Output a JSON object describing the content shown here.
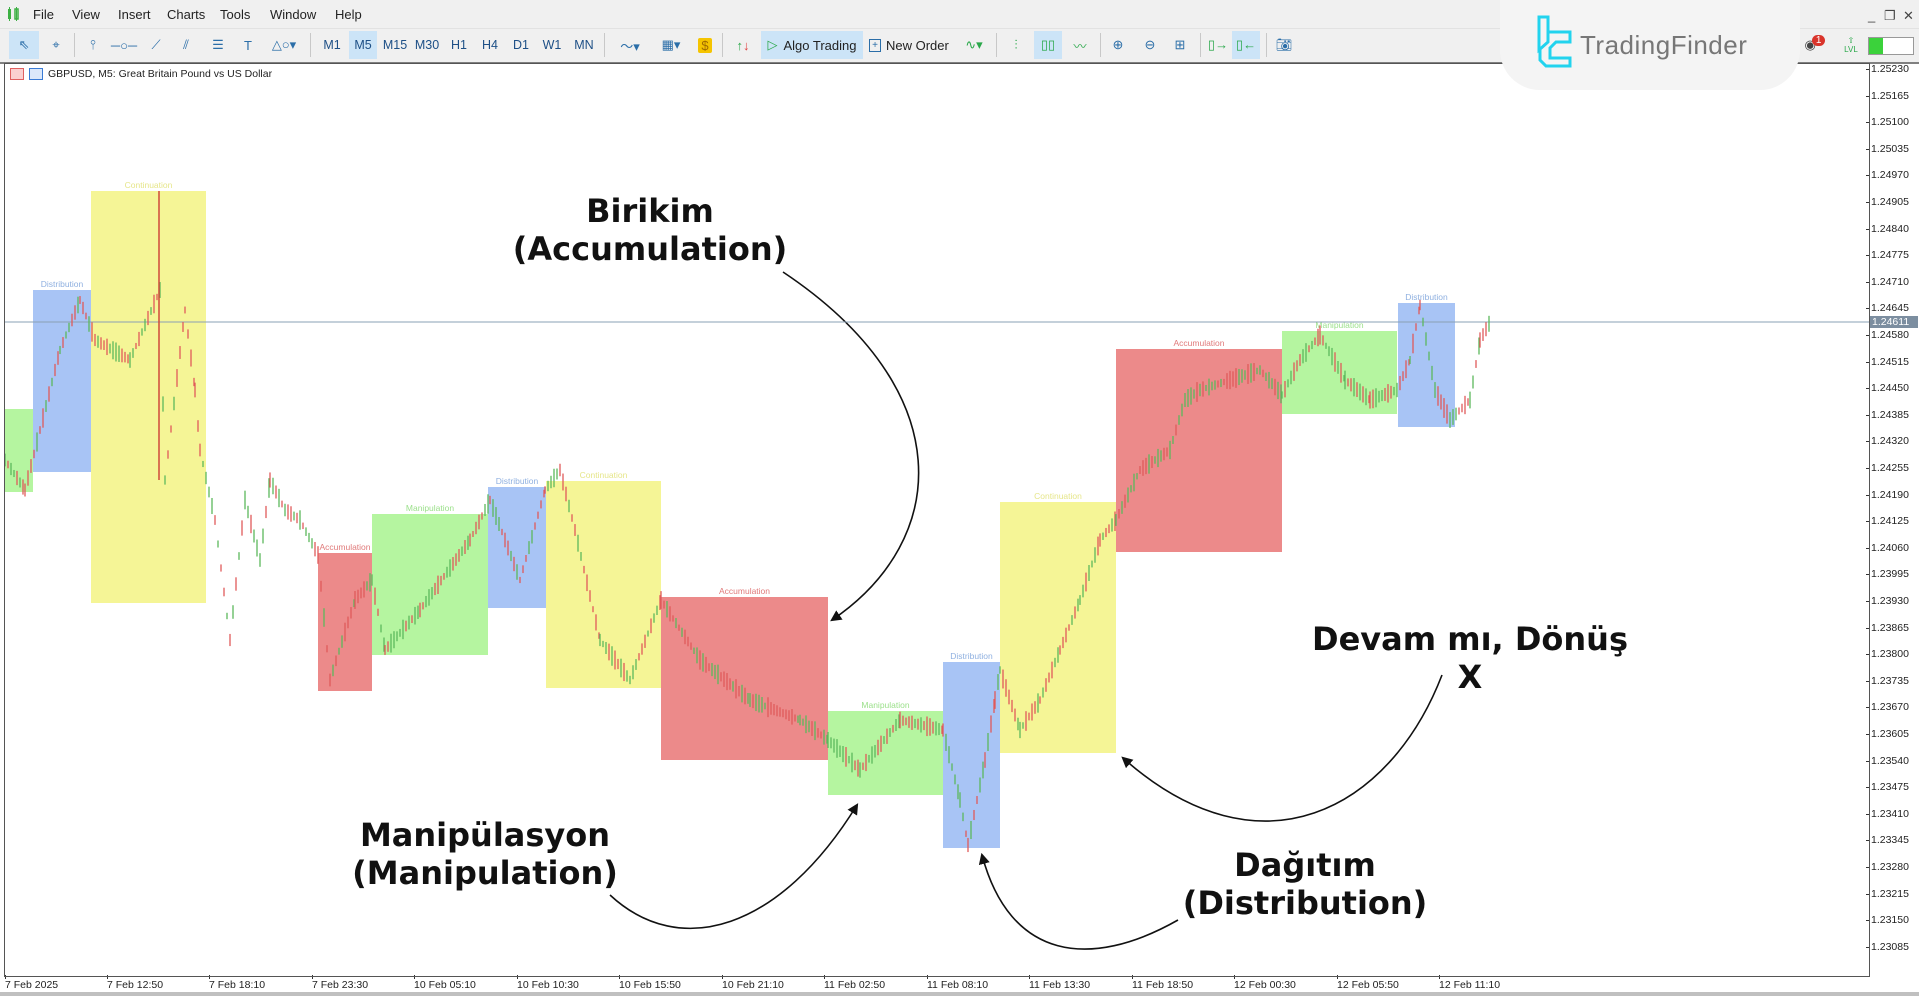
{
  "menu": {
    "items": [
      "File",
      "View",
      "Insert",
      "Charts",
      "Tools",
      "Window",
      "Help"
    ]
  },
  "toolbar": {
    "timeframes": [
      "M1",
      "M5",
      "M15",
      "M30",
      "H1",
      "H4",
      "D1",
      "W1",
      "MN"
    ],
    "active_timeframe": "M5",
    "algo_trading_label": "Algo Trading",
    "new_order_label": "New Order",
    "notification_count": "1",
    "level_label": "LVL"
  },
  "brand": {
    "name": "TradingFinder",
    "accent": "#22d3ee"
  },
  "chart": {
    "title": "GBPUSD, M5:  Great Britain Pound vs US Dollar",
    "current_price": "1.24611",
    "price_labels": [
      "1.25230",
      "1.25165",
      "1.25100",
      "1.25035",
      "1.24970",
      "1.24905",
      "1.24840",
      "1.24775",
      "1.24710",
      "1.24645",
      "1.24580",
      "1.24515",
      "1.24450",
      "1.24385",
      "1.24320",
      "1.24255",
      "1.24190",
      "1.24125",
      "1.24060",
      "1.23995",
      "1.23930",
      "1.23865",
      "1.23800",
      "1.23735",
      "1.23670",
      "1.23605",
      "1.23540",
      "1.23475",
      "1.23410",
      "1.23345",
      "1.23280",
      "1.23215",
      "1.23150",
      "1.23085"
    ],
    "time_labels": [
      "7 Feb 2025",
      "7 Feb 12:50",
      "7 Feb 18:10",
      "7 Feb 23:30",
      "10 Feb 05:10",
      "10 Feb 10:30",
      "10 Feb 15:50",
      "10 Feb 21:10",
      "11 Feb 02:50",
      "11 Feb 08:10",
      "11 Feb 13:30",
      "11 Feb 18:50",
      "12 Feb 00:30",
      "12 Feb 05:50",
      "12 Feb 11:10"
    ],
    "phase_colors": {
      "Accumulation": "#ec8a8a",
      "Manipulation": "#b5f5a0",
      "Distribution": "#a8c4f5",
      "Continuation": "#f5f596"
    },
    "phases": [
      {
        "type": "Manipulation",
        "label": ""
      },
      {
        "type": "Distribution",
        "label": "Distribution"
      },
      {
        "type": "Continuation",
        "label": "Continuation"
      },
      {
        "type": "Accumulation",
        "label": "Accumulation"
      },
      {
        "type": "Manipulation",
        "label": "Manipulation"
      },
      {
        "type": "Distribution",
        "label": "Distribution"
      },
      {
        "type": "Continuation",
        "label": "Continuation"
      },
      {
        "type": "Accumulation",
        "label": "Accumulation"
      },
      {
        "type": "Manipulation",
        "label": "Manipulation"
      },
      {
        "type": "Distribution",
        "label": "Distribution"
      },
      {
        "type": "Continuation",
        "label": "Continuation"
      },
      {
        "type": "Accumulation",
        "label": "Accumulation"
      },
      {
        "type": "Manipulation",
        "label": "Manipulation"
      },
      {
        "type": "Distribution",
        "label": "Distribution"
      }
    ]
  },
  "annotations": {
    "accumulation": {
      "line1": "Birikim",
      "line2": "(Accumulation)"
    },
    "manipulation": {
      "line1": "Manipülasyon",
      "line2": "(Manipulation)"
    },
    "distribution": {
      "line1": "Dağıtım",
      "line2": "(Distribution)"
    },
    "continuation": {
      "line1": "Devam mı, Dönüş X"
    }
  }
}
